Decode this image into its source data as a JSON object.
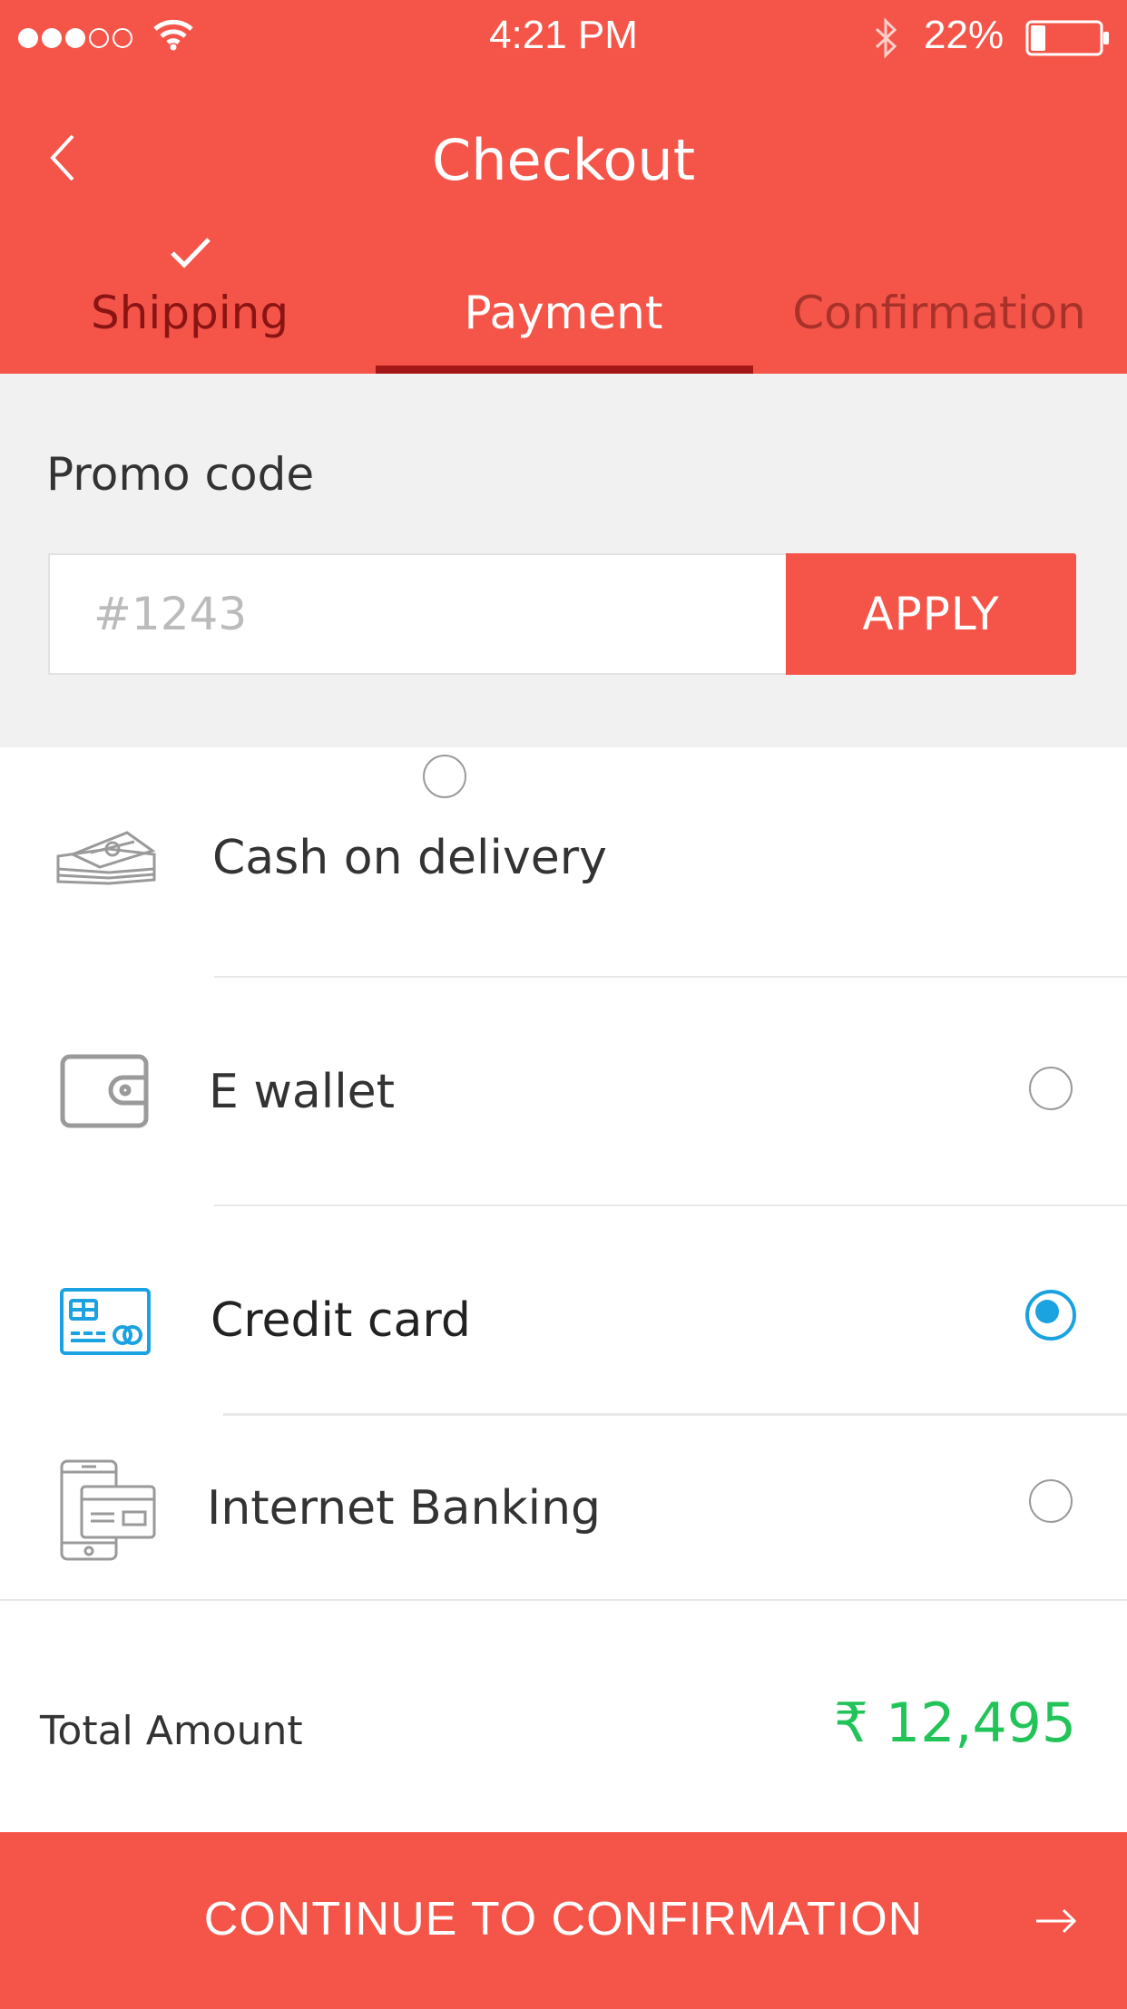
{
  "status_bar": {
    "time": "4:21 PM",
    "battery_percent": "22%",
    "battery_level": 0.22,
    "signal_bars_filled": 3,
    "signal_bars_total": 5,
    "icons": [
      "wifi-icon",
      "bluetooth-icon",
      "battery-icon"
    ]
  },
  "header": {
    "title": "Checkout",
    "back_icon": "chevron-left-icon",
    "tabs": [
      {
        "label": "Shipping",
        "state": "completed",
        "icon": "check-icon"
      },
      {
        "label": "Payment",
        "state": "active"
      },
      {
        "label": "Confirmation",
        "state": "upcoming"
      }
    ]
  },
  "promo": {
    "label": "Promo code",
    "placeholder": "#1243",
    "value": "",
    "apply_label": "APPLY"
  },
  "payment_options": [
    {
      "label": "Cash on delivery",
      "icon": "cash-icon",
      "selected": false
    },
    {
      "label": "E wallet",
      "icon": "wallet-icon",
      "selected": false
    },
    {
      "label": "Credit card",
      "icon": "credit-card-icon",
      "selected": true
    },
    {
      "label": "Internet Banking",
      "icon": "internet-banking-icon",
      "selected": false
    }
  ],
  "total": {
    "label": "Total Amount",
    "value": "₹ 12,495"
  },
  "continue_button": {
    "label": "CONTINUE TO CONFIRMATION",
    "icon": "arrow-right-icon"
  },
  "colors": {
    "brand": "#f55549",
    "active_tab_underline": "#a31717",
    "selected_radio": "#1ba2e0",
    "total_amount": "#22c45a"
  }
}
